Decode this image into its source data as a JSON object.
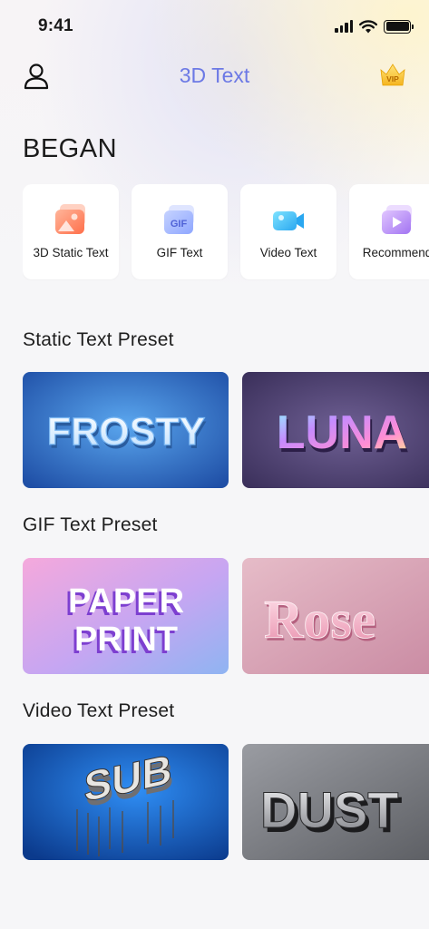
{
  "status_bar": {
    "time": "9:41"
  },
  "header": {
    "title": "3D Text",
    "vip_label": "VIP"
  },
  "began": {
    "title": "BEGAN"
  },
  "categories": [
    {
      "label": "3D Static Text",
      "icon": "image-icon"
    },
    {
      "label": "GIF Text",
      "icon": "gif-icon"
    },
    {
      "label": "Video Text",
      "icon": "video-camera-icon"
    },
    {
      "label": "Recommend",
      "icon": "play-icon"
    }
  ],
  "sections": {
    "static": {
      "title": "Static Text Preset",
      "presets": [
        {
          "text": "FROSTY"
        },
        {
          "text": "LUNA"
        }
      ]
    },
    "gif": {
      "title": "GIF Text Preset",
      "presets": [
        {
          "text_line1": "PAPER",
          "text_line2": "PRINT"
        },
        {
          "text": "Rose"
        }
      ]
    },
    "video": {
      "title": "Video Text Preset",
      "presets": [
        {
          "text": "SUB"
        },
        {
          "text": "DUST"
        }
      ]
    }
  },
  "colors": {
    "title_accent": "#6c79e5",
    "background": "#f6f6f8",
    "card": "#ffffff"
  }
}
